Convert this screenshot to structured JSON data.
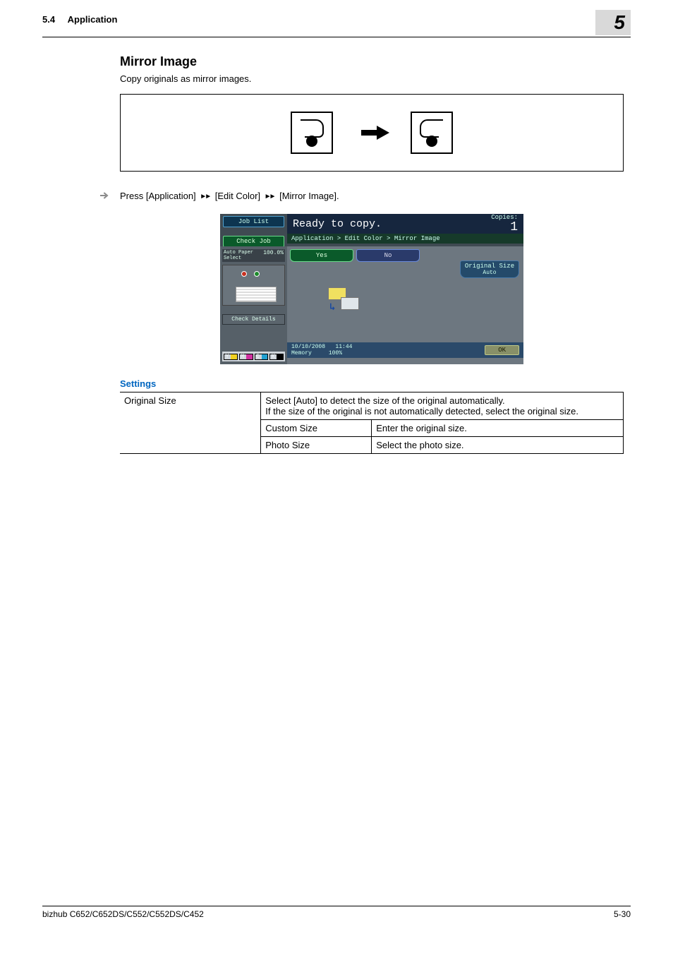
{
  "header": {
    "section_number": "5.4",
    "section_label": "Application",
    "chapter_number": "5"
  },
  "main": {
    "title": "Mirror Image",
    "description": "Copy originals as mirror images.",
    "instruction_prefix": "Press ",
    "bc1": "[Application]",
    "bc2": "[Edit Color]",
    "bc3": "[Mirror Image]",
    "instruction_suffix": "."
  },
  "panel": {
    "joblist": "Job List",
    "checkjob": "Check Job",
    "ready": "Ready to copy.",
    "copies_label": "Copies:",
    "copies_value": "1",
    "breadcrumb": "Application > Edit Color > Mirror Image",
    "autopaper_label": "Auto Paper Select",
    "autopaper_pct": "100.0%",
    "checkdet": "Check Details",
    "tab_yes": "Yes",
    "tab_no": "No",
    "orig_btn": "Original Size",
    "orig_sub": "Auto",
    "status_date": "10/10/2008",
    "status_time": "11:44",
    "status_mem": "Memory",
    "status_mem_pct": "100%",
    "ok": "OK",
    "toner": {
      "y": "Y",
      "m": "M",
      "c": "C",
      "k": "K"
    }
  },
  "settings": {
    "heading": "Settings",
    "row_label": "Original Size",
    "row_desc": "Select [Auto] to detect the size of the original automatically.\nIf the size of the original is not automatically detected, select the original size.",
    "sub1_label": "Custom Size",
    "sub1_desc": "Enter the original size.",
    "sub2_label": "Photo Size",
    "sub2_desc": "Select the photo size."
  },
  "footer": {
    "left": "bizhub C652/C652DS/C552/C552DS/C452",
    "right": "5-30"
  }
}
